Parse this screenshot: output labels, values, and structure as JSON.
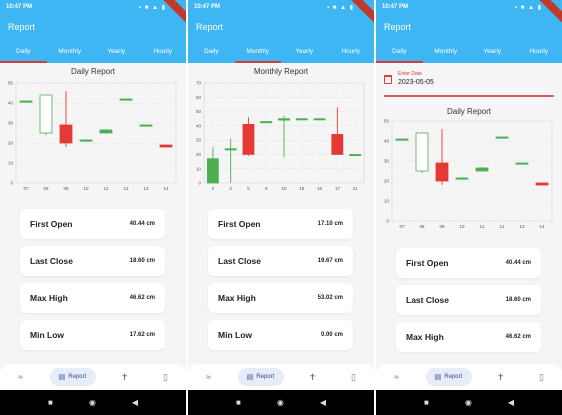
{
  "statusbar": {
    "time": "10:47 PM",
    "icons": "▪ ■ ▲ ▮"
  },
  "appbar": {
    "title": "Report"
  },
  "tabs": [
    "Daily",
    "Monthly",
    "Yearly",
    "Hourly"
  ],
  "screens": [
    {
      "active_tab": 0,
      "chart_title": "Daily Report",
      "cards": [
        {
          "label": "First Open",
          "value": "40.44 cm"
        },
        {
          "label": "Last Close",
          "value": "18.60 cm"
        },
        {
          "label": "Max High",
          "value": "46.62 cm"
        },
        {
          "label": "Min Low",
          "value": "17.62 cm"
        }
      ]
    },
    {
      "active_tab": 1,
      "chart_title": "Monthly Report",
      "cards": [
        {
          "label": "First Open",
          "value": "17.10 cm"
        },
        {
          "label": "Last Close",
          "value": "19.67 cm"
        },
        {
          "label": "Max High",
          "value": "53.02 cm"
        },
        {
          "label": "Min Low",
          "value": "0.00 cm"
        }
      ]
    },
    {
      "active_tab": 0,
      "date_field": {
        "label": "Enter Date",
        "value": "2023-05-05"
      },
      "chart_title": "Daily Report",
      "cards": [
        {
          "label": "First Open",
          "value": "40.44 cm"
        },
        {
          "label": "Last Close",
          "value": "18.60 cm"
        },
        {
          "label": "Max High",
          "value": "46.62 cm"
        }
      ]
    }
  ],
  "bottom_nav": {
    "active_label": "Report",
    "icons": [
      "wave-icon",
      "report-icon",
      "person-icon",
      "phone-icon"
    ]
  },
  "colors": {
    "primary": "#3fb6f4",
    "up": "#4caf50",
    "down": "#e53935",
    "tab_indicator": "#d93a3a"
  },
  "chart_data": [
    {
      "type": "candlestick",
      "title": "Daily Report",
      "x": [
        "07",
        "08",
        "09",
        "10",
        "11",
        "12",
        "13",
        "14"
      ],
      "ylim": [
        0,
        50
      ],
      "yticks": [
        0,
        10,
        20,
        30,
        40,
        50
      ],
      "ohlc": [
        {
          "open": 41,
          "high": 41,
          "low": 41,
          "close": 41
        },
        {
          "open": 25,
          "high": 44,
          "low": 24,
          "close": 44
        },
        {
          "open": 29,
          "high": 46,
          "low": 18,
          "close": 20
        },
        {
          "open": 21,
          "high": 22,
          "low": 21,
          "close": 21.5
        },
        {
          "open": 25,
          "high": 27,
          "low": 25,
          "close": 26.5
        },
        {
          "open": 42,
          "high": 42,
          "low": 42,
          "close": 42
        },
        {
          "open": 29,
          "high": 29,
          "low": 29,
          "close": 29
        },
        {
          "open": 19,
          "high": 19,
          "low": 18,
          "close": 18
        }
      ]
    },
    {
      "type": "candlestick",
      "title": "Monthly Report",
      "x": [
        "2",
        "3",
        "5",
        "9",
        "10",
        "15",
        "16",
        "17",
        "21"
      ],
      "ylim": [
        0,
        70
      ],
      "yticks": [
        0,
        10,
        20,
        30,
        40,
        50,
        60,
        70
      ],
      "ohlc": [
        {
          "open": 0,
          "high": 25,
          "low": 0,
          "close": 17
        },
        {
          "open": 24,
          "high": 31,
          "low": 0,
          "close": 24
        },
        {
          "open": 41,
          "high": 46,
          "low": 19,
          "close": 20
        },
        {
          "open": 43,
          "high": 43,
          "low": 43,
          "close": 43
        },
        {
          "open": 44,
          "high": 47,
          "low": 18,
          "close": 45
        },
        {
          "open": 45,
          "high": 45,
          "low": 45,
          "close": 45
        },
        {
          "open": 45,
          "high": 45,
          "low": 45,
          "close": 45
        },
        {
          "open": 34,
          "high": 53,
          "low": 20,
          "close": 20
        },
        {
          "open": 20,
          "high": 20,
          "low": 20,
          "close": 20
        }
      ]
    }
  ]
}
